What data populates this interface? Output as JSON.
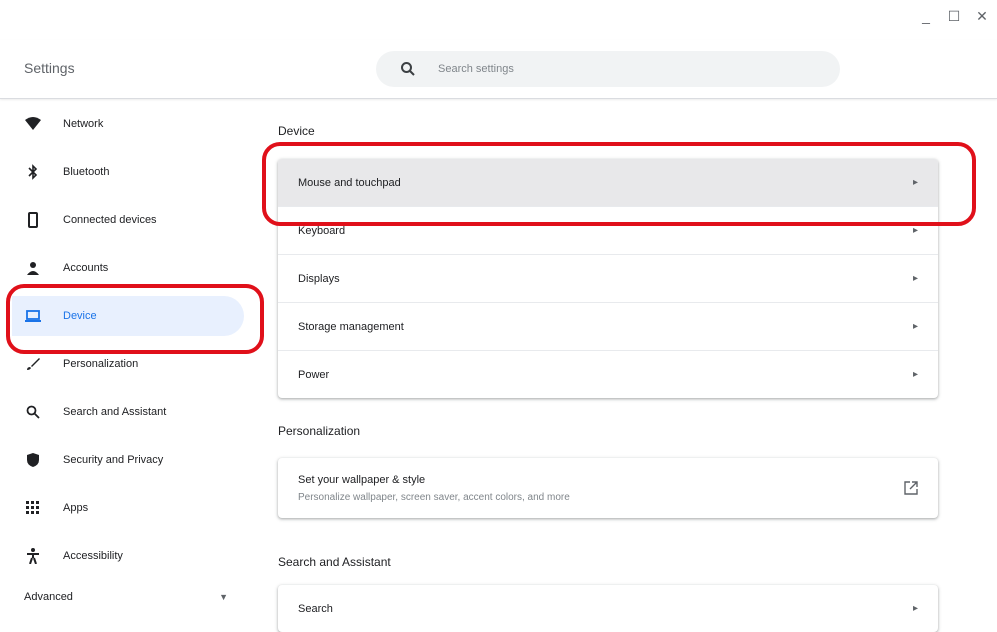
{
  "window": {
    "minimize": "_",
    "maximize": "☐",
    "close": "✕"
  },
  "header": {
    "title": "Settings",
    "search_placeholder": "Search settings"
  },
  "sidebar": {
    "items": [
      {
        "label": "Network",
        "icon": "wifi-icon"
      },
      {
        "label": "Bluetooth",
        "icon": "bluetooth-icon"
      },
      {
        "label": "Connected devices",
        "icon": "phone-icon"
      },
      {
        "label": "Accounts",
        "icon": "person-icon"
      },
      {
        "label": "Device",
        "icon": "laptop-icon"
      },
      {
        "label": "Personalization",
        "icon": "brush-icon"
      },
      {
        "label": "Search and Assistant",
        "icon": "search-icon"
      },
      {
        "label": "Security and Privacy",
        "icon": "shield-icon"
      },
      {
        "label": "Apps",
        "icon": "apps-grid-icon"
      },
      {
        "label": "Accessibility",
        "icon": "accessibility-icon"
      }
    ],
    "advanced_label": "Advanced",
    "active": "Device"
  },
  "main": {
    "device_section_title": "Device",
    "device_rows": [
      {
        "label": "Mouse and touchpad"
      },
      {
        "label": "Keyboard"
      },
      {
        "label": "Displays"
      },
      {
        "label": "Storage management"
      },
      {
        "label": "Power"
      }
    ],
    "personalization_title": "Personalization",
    "wallpaper": {
      "title": "Set your wallpaper & style",
      "subtitle": "Personalize wallpaper, screen saver, accent colors, and more"
    },
    "search_section_title": "Search and Assistant",
    "search_row_label": "Search"
  },
  "colors": {
    "accent": "#1a73e8",
    "active_bg": "#e8f0fe",
    "highlight": "#e0101a"
  }
}
